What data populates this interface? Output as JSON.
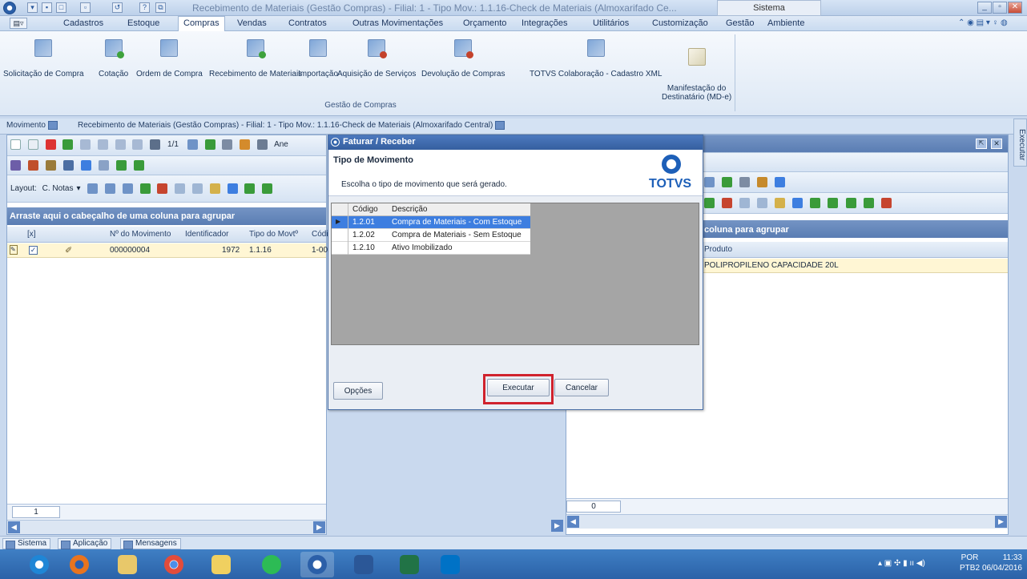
{
  "window": {
    "title": "Recebimento de Materiais (Gestão Compras) - Filial: 1 - Tipo Mov.: 1.1.16-Check de Materiais (Almoxarifado Ce...",
    "system_box": "Sistema"
  },
  "menu": {
    "items": [
      "Cadastros",
      "Estoque",
      "Compras",
      "Vendas",
      "Contratos",
      "Outras Movimentações",
      "Orçamento",
      "Integrações",
      "Utilitários",
      "Customização",
      "Gestão",
      "Ambiente"
    ],
    "active": "Compras"
  },
  "ribbon": {
    "buttons": [
      "Solicitação de Compra",
      "Cotação",
      "Ordem de Compra",
      "Recebimento de Materiais",
      "Importação",
      "Aquisição de Serviços",
      "Devolução de Compras",
      "TOTVS Colaboração - Cadastro XML",
      "Manifestação do\nDestinatário (MD-e)"
    ],
    "group_label": "Gestão de Compras"
  },
  "doc_tabs": {
    "first": "Movimento",
    "second": "Recebimento de Materiais (Gestão Compras) - Filial: 1 - Tipo Mov.: 1.1.16-Check de Materiais (Almoxarifado Central)"
  },
  "left_panel": {
    "pager": "1/1",
    "anexos_partial": "Ane",
    "layout_label": "Layout:",
    "layout_value": "C. Notas",
    "group_header": "Arraste aqui o cabeçalho de uma coluna para agrupar",
    "columns": [
      "[x]",
      "Nº do Movimento",
      "Identificador",
      "Tipo do Movtº",
      "Códi"
    ],
    "row": {
      "numero": "000000004",
      "identificador": "1972",
      "tipo": "1.1.16",
      "codigo": "1-00"
    },
    "footer_count": "1"
  },
  "right_panel": {
    "group_header": "coluna para agrupar",
    "column": "Produto",
    "row_text": "POLIPROPILENO CAPACIDADE 20L",
    "footer_count": "0",
    "side_tab": "Executar"
  },
  "dialog": {
    "title": "Faturar / Receber",
    "section_title": "Tipo de Movimento",
    "instruction": "Escolha o tipo de movimento que será gerado.",
    "logo_text": "TOTVS",
    "columns": [
      "Código",
      "Descrição"
    ],
    "rows": [
      {
        "codigo": "1.2.01",
        "descricao": "Compra de Materiais - Com Estoque"
      },
      {
        "codigo": "1.2.02",
        "descricao": "Compra de Materiais - Sem Estoque"
      },
      {
        "codigo": "1.2.10",
        "descricao": "Ativo Imobilizado"
      }
    ],
    "buttons": {
      "opcoes": "Opções",
      "executar": "Executar",
      "cancelar": "Cancelar"
    }
  },
  "status_tabs": [
    "Sistema",
    "Aplicação",
    "Mensagens"
  ],
  "tray": {
    "lang": "POR",
    "layout": "PTB2",
    "time": "11:33",
    "date": "06/04/2016"
  },
  "colors": {
    "selection": "#3d7ee0",
    "highlight": "#d0222d",
    "title_blue": "#355f9f"
  }
}
